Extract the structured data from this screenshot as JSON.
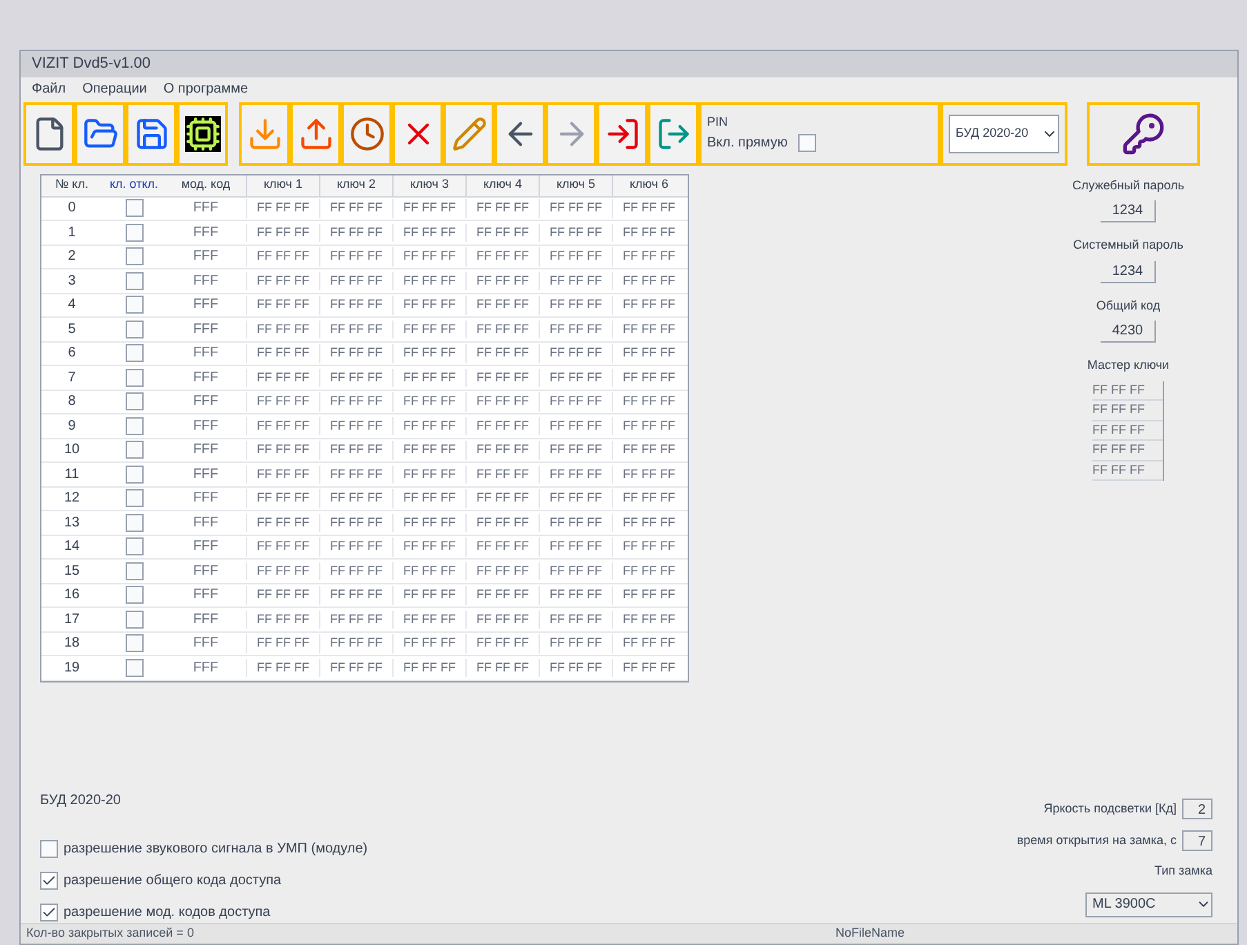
{
  "window": {
    "title": "VIZIT Dvd5-v1.00"
  },
  "menu": [
    "Файл",
    "Операции",
    "О программе"
  ],
  "toolbar": [
    {
      "kind": "new"
    },
    {
      "kind": "open"
    },
    {
      "kind": "save"
    },
    {
      "kind": "chip"
    },
    {
      "kind": "read"
    },
    {
      "kind": "write"
    },
    {
      "kind": "time"
    },
    {
      "kind": "erase"
    },
    {
      "kind": "edit"
    },
    {
      "kind": "back"
    },
    {
      "kind": "forward"
    },
    {
      "kind": "import"
    },
    {
      "kind": "exit"
    }
  ],
  "pin_panel": {
    "title": "PIN",
    "label": "Вкл. прямую",
    "checked": false
  },
  "device_select": {
    "value": "БУД 2020-20"
  },
  "table": {
    "columns": [
      "№ кл.",
      "кл. откл.",
      "мод. код",
      "ключ 1",
      "ключ 2",
      "ключ 3",
      "ключ 4",
      "ключ 5",
      "ключ 6"
    ],
    "rows": [
      {
        "num": "0",
        "checked": false,
        "code": "FFF",
        "keys": [
          "FF FF FF",
          "FF FF FF",
          "FF FF FF",
          "FF FF FF",
          "FF FF FF",
          "FF FF FF"
        ]
      },
      {
        "num": "1",
        "checked": false,
        "code": "FFF",
        "keys": [
          "FF FF FF",
          "FF FF FF",
          "FF FF FF",
          "FF FF FF",
          "FF FF FF",
          "FF FF FF"
        ]
      },
      {
        "num": "2",
        "checked": false,
        "code": "FFF",
        "keys": [
          "FF FF FF",
          "FF FF FF",
          "FF FF FF",
          "FF FF FF",
          "FF FF FF",
          "FF FF FF"
        ]
      },
      {
        "num": "3",
        "checked": false,
        "code": "FFF",
        "keys": [
          "FF FF FF",
          "FF FF FF",
          "FF FF FF",
          "FF FF FF",
          "FF FF FF",
          "FF FF FF"
        ]
      },
      {
        "num": "4",
        "checked": false,
        "code": "FFF",
        "keys": [
          "FF FF FF",
          "FF FF FF",
          "FF FF FF",
          "FF FF FF",
          "FF FF FF",
          "FF FF FF"
        ]
      },
      {
        "num": "5",
        "checked": false,
        "code": "FFF",
        "keys": [
          "FF FF FF",
          "FF FF FF",
          "FF FF FF",
          "FF FF FF",
          "FF FF FF",
          "FF FF FF"
        ]
      },
      {
        "num": "6",
        "checked": false,
        "code": "FFF",
        "keys": [
          "FF FF FF",
          "FF FF FF",
          "FF FF FF",
          "FF FF FF",
          "FF FF FF",
          "FF FF FF"
        ]
      },
      {
        "num": "7",
        "checked": false,
        "code": "FFF",
        "keys": [
          "FF FF FF",
          "FF FF FF",
          "FF FF FF",
          "FF FF FF",
          "FF FF FF",
          "FF FF FF"
        ]
      },
      {
        "num": "8",
        "checked": false,
        "code": "FFF",
        "keys": [
          "FF FF FF",
          "FF FF FF",
          "FF FF FF",
          "FF FF FF",
          "FF FF FF",
          "FF FF FF"
        ]
      },
      {
        "num": "9",
        "checked": false,
        "code": "FFF",
        "keys": [
          "FF FF FF",
          "FF FF FF",
          "FF FF FF",
          "FF FF FF",
          "FF FF FF",
          "FF FF FF"
        ]
      },
      {
        "num": "10",
        "checked": false,
        "code": "FFF",
        "keys": [
          "FF FF FF",
          "FF FF FF",
          "FF FF FF",
          "FF FF FF",
          "FF FF FF",
          "FF FF FF"
        ]
      },
      {
        "num": "11",
        "checked": false,
        "code": "FFF",
        "keys": [
          "FF FF FF",
          "FF FF FF",
          "FF FF FF",
          "FF FF FF",
          "FF FF FF",
          "FF FF FF"
        ]
      },
      {
        "num": "12",
        "checked": false,
        "code": "FFF",
        "keys": [
          "FF FF FF",
          "FF FF FF",
          "FF FF FF",
          "FF FF FF",
          "FF FF FF",
          "FF FF FF"
        ]
      },
      {
        "num": "13",
        "checked": false,
        "code": "FFF",
        "keys": [
          "FF FF FF",
          "FF FF FF",
          "FF FF FF",
          "FF FF FF",
          "FF FF FF",
          "FF FF FF"
        ]
      },
      {
        "num": "14",
        "checked": false,
        "code": "FFF",
        "keys": [
          "FF FF FF",
          "FF FF FF",
          "FF FF FF",
          "FF FF FF",
          "FF FF FF",
          "FF FF FF"
        ]
      },
      {
        "num": "15",
        "checked": false,
        "code": "FFF",
        "keys": [
          "FF FF FF",
          "FF FF FF",
          "FF FF FF",
          "FF FF FF",
          "FF FF FF",
          "FF FF FF"
        ]
      },
      {
        "num": "16",
        "checked": false,
        "code": "FFF",
        "keys": [
          "FF FF FF",
          "FF FF FF",
          "FF FF FF",
          "FF FF FF",
          "FF FF FF",
          "FF FF FF"
        ]
      },
      {
        "num": "17",
        "checked": false,
        "code": "FFF",
        "keys": [
          "FF FF FF",
          "FF FF FF",
          "FF FF FF",
          "FF FF FF",
          "FF FF FF",
          "FF FF FF"
        ]
      },
      {
        "num": "18",
        "checked": false,
        "code": "FFF",
        "keys": [
          "FF FF FF",
          "FF FF FF",
          "FF FF FF",
          "FF FF FF",
          "FF FF FF",
          "FF FF FF"
        ]
      },
      {
        "num": "19",
        "checked": false,
        "code": "FFF",
        "keys": [
          "FF FF FF",
          "FF FF FF",
          "FF FF FF",
          "FF FF FF",
          "FF FF FF",
          "FF FF FF"
        ]
      }
    ]
  },
  "passwords": [
    {
      "label": "Служебный пароль",
      "value": "1234"
    },
    {
      "label": "Системный пароль",
      "value": "1234"
    },
    {
      "label": "Общий код",
      "value": "4230"
    }
  ],
  "master_keys": {
    "label": "Мастер ключи",
    "items": [
      "FF FF FF",
      "FF FF FF",
      "FF FF FF",
      "FF FF FF",
      "FF FF FF"
    ]
  },
  "device_label": "БУД 2020-20",
  "options": [
    {
      "label": "разрешение звукового сигнала в УМП (модуле)",
      "checked": false
    },
    {
      "label": "разрешение общего кода доступа",
      "checked": true
    },
    {
      "label": "разрешение мод. кодов доступа",
      "checked": true
    }
  ],
  "settings": [
    {
      "label": "Яркость подсветки [Кд]",
      "value": "2"
    },
    {
      "label": "время открытия на замка, с",
      "value": "7"
    }
  ],
  "lock_type": {
    "label": "Тип замка",
    "value": "ML 3900C"
  },
  "status_bar": [
    "Кол-во закрытых записей = 0",
    "NoFileName"
  ]
}
